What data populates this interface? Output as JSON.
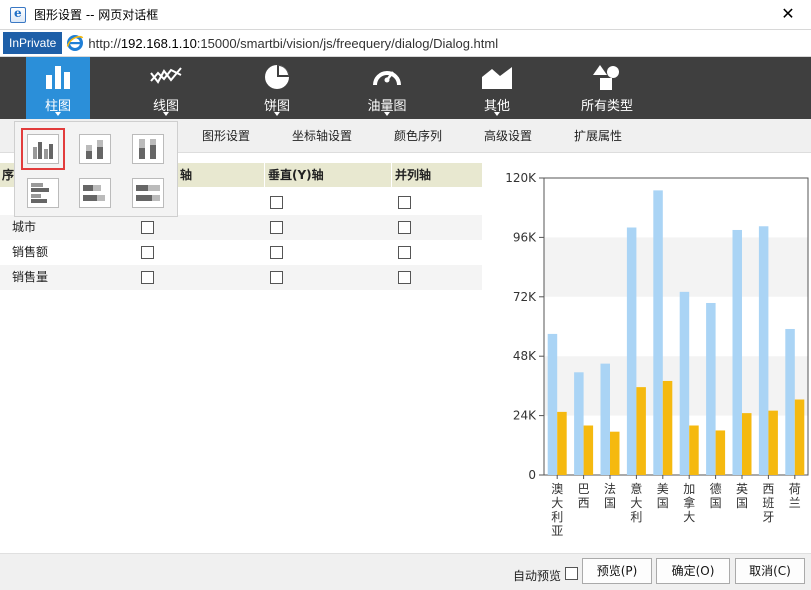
{
  "window": {
    "title": "图形设置 -- 网页对话框",
    "close_glyph": "✕"
  },
  "address": {
    "inprivate": "InPrivate",
    "url_scheme": "http://",
    "url_host": "192.168.1.10",
    "url_rest": ":15000/smartbi/vision/js/freequery/dialog/Dialog.html"
  },
  "types": [
    {
      "label": "柱图",
      "icon": "bar-chart-icon",
      "active": true
    },
    {
      "label": "线图",
      "icon": "line-chart-icon",
      "active": false
    },
    {
      "label": "饼图",
      "icon": "pie-chart-icon",
      "active": false
    },
    {
      "label": "油量图",
      "icon": "gauge-icon",
      "active": false
    },
    {
      "label": "其他",
      "icon": "area-chart-icon",
      "active": false
    },
    {
      "label": "所有类型",
      "icon": "shapes-icon",
      "active": false
    }
  ],
  "tabs": [
    "图形设置",
    "坐标轴设置",
    "颜色序列",
    "高级设置",
    "扩展属性"
  ],
  "grid": {
    "headers": [
      "序",
      "轴",
      "垂直(Y)轴",
      "并列轴"
    ],
    "rows": [
      {
        "label": ""
      },
      {
        "label": "城市"
      },
      {
        "label": "销售额"
      },
      {
        "label": "销售量"
      }
    ]
  },
  "footer": {
    "auto_preview": "自动预览",
    "preview": "预览(P)",
    "ok": "确定(O)",
    "cancel": "取消(C)"
  },
  "colors": {
    "series1": "#aad4f5",
    "series2": "#f5b90f",
    "toolbar_bg": "#3f3f3f",
    "active_type": "#2b8fd9"
  },
  "chart_data": {
    "type": "bar",
    "categories": [
      "澳大利亚",
      "巴西",
      "法国",
      "意大利",
      "美国",
      "加拿大",
      "德国",
      "英国",
      "西班牙",
      "荷兰"
    ],
    "series": [
      {
        "values": [
          57000,
          41500,
          45000,
          100000,
          115000,
          74000,
          69500,
          99000,
          100500,
          59000
        ]
      },
      {
        "values": [
          25500,
          20000,
          17500,
          35500,
          38000,
          20000,
          18000,
          25000,
          26000,
          30500
        ]
      }
    ],
    "yticks": [
      "0",
      "24K",
      "48K",
      "72K",
      "96K",
      "120K"
    ],
    "ylim": [
      0,
      120000
    ],
    "grid": "alternating bands"
  }
}
